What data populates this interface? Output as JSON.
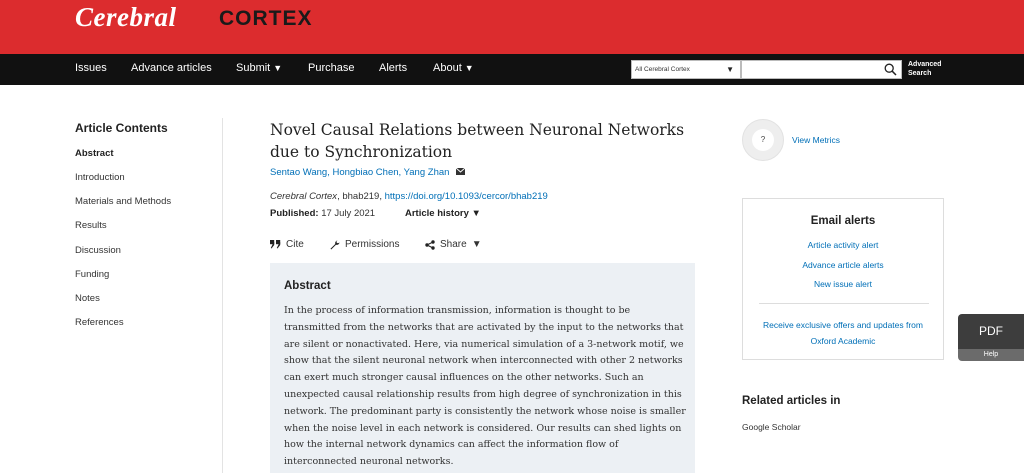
{
  "header": {
    "brand_cerebral": "Cerebral",
    "brand_cortex": "CORTEX",
    "colors": {
      "brand_red": "#dc2c2e",
      "nav_bg": "#111111",
      "link_blue": "#006fb7"
    }
  },
  "nav": {
    "issues": "Issues",
    "advance_articles": "Advance articles",
    "submit": "Submit",
    "purchase": "Purchase",
    "alerts": "Alerts",
    "about": "About",
    "caret": "▼"
  },
  "search": {
    "scope_selected": "All Cerebral Cortex",
    "caret": "▼",
    "input_value": "",
    "advanced_line1": "Advanced",
    "advanced_line2": "Search",
    "icon": "search-icon"
  },
  "toc": {
    "title": "Article Contents",
    "items": [
      {
        "label": "Abstract"
      },
      {
        "label": "Introduction"
      },
      {
        "label": "Materials and Methods"
      },
      {
        "label": "Results"
      },
      {
        "label": "Discussion"
      },
      {
        "label": "Funding"
      },
      {
        "label": "Notes"
      },
      {
        "label": "References"
      }
    ]
  },
  "article": {
    "title": "Novel Causal Relations between Neuronal Networks due to Synchronization",
    "authors": [
      "Sentao Wang",
      "Hongbiao Chen",
      "Yang Zhan"
    ],
    "author_sep": ", ",
    "journal": "Cerebral Cortex",
    "article_id": ", bhab219, ",
    "doi": "https://doi.org/10.1093/cercor/bhab219",
    "published_label": "Published:",
    "published_date": " 17 July 2021",
    "history_label": "Article history",
    "history_caret": "▼",
    "tools": {
      "cite": "Cite",
      "permissions": "Permissions",
      "share": "Share",
      "share_caret": "▼"
    }
  },
  "abstract": {
    "heading": "Abstract",
    "text": "In the process of information transmission, information is thought to be transmitted from the networks that are activated by the input to the networks that are silent or nonactivated. Here, via numerical simulation of a 3-network motif, we show that the silent neuronal network when interconnected with other 2 networks can exert much stronger causal influences on the other networks. Such an unexpected causal relationship results from high degree of synchronization in this network. The predominant party is consistently the network whose noise is smaller when the noise level in each network is considered. Our results can shed lights on how the internal network dynamics can affect the information flow of interconnected neuronal networks."
  },
  "sidebar": {
    "metrics_badge": "?",
    "view_metrics": "View Metrics",
    "email_alerts_title": "Email alerts",
    "email_links": [
      "Article activity alert",
      "Advance article alerts",
      "New issue alert"
    ],
    "offer_text": "Receive exclusive offers and updates from Oxford Academic",
    "related_title": "Related articles in",
    "related_items": [
      "Google Scholar"
    ]
  },
  "floating": {
    "pdf": "PDF",
    "help": "Help"
  }
}
